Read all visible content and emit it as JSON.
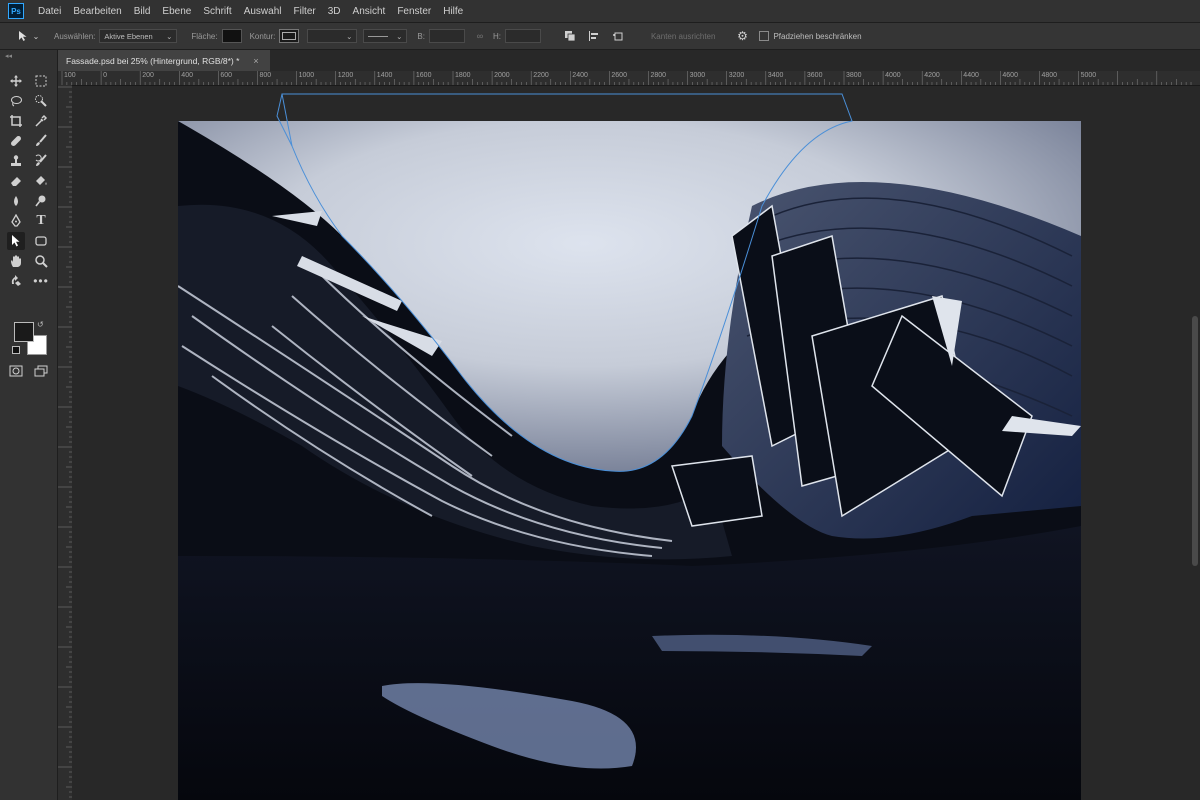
{
  "menu": {
    "app_icon": "Ps",
    "items": [
      "Datei",
      "Bearbeiten",
      "Bild",
      "Ebene",
      "Schrift",
      "Auswahl",
      "Filter",
      "3D",
      "Ansicht",
      "Fenster",
      "Hilfe"
    ]
  },
  "options": {
    "select_label": "Auswählen:",
    "select_value": "Aktive Ebenen",
    "fill_label": "Fläche:",
    "stroke_label": "Kontur:",
    "width_label": "B:",
    "height_label": "H:",
    "align_edges_label": "Kanten ausrichten",
    "constrain_label": "Pfadziehen beschränken"
  },
  "document": {
    "tab_title": "Fassade.psd bei 25% (Hintergrund, RGB/8*) *",
    "close": "×"
  },
  "ruler": {
    "top_labels": [
      "100",
      "0",
      "200",
      "400",
      "600",
      "800",
      "1000",
      "1200",
      "1400",
      "1600",
      "1800",
      "2000",
      "2200",
      "2400",
      "2600",
      "2800",
      "3000",
      "3200",
      "3400",
      "3600",
      "3800",
      "4000",
      "4200",
      "4400",
      "4600",
      "4800",
      "5000"
    ]
  },
  "colors": {
    "accent": "#31a8ff",
    "foreground": "#1a1a1a",
    "background": "#ffffff",
    "path_outline": "#4a8fd8"
  },
  "tools": [
    "move-icon",
    "marquee-icon",
    "lasso-icon",
    "quick-select-icon",
    "crop-icon",
    "eyedropper-icon",
    "healing-icon",
    "brush-icon",
    "clone-stamp-icon",
    "history-brush-icon",
    "eraser-icon",
    "paint-bucket-icon",
    "blur-icon",
    "dodge-icon",
    "pen-icon",
    "type-icon",
    "path-select-icon",
    "rectangle-icon",
    "hand-icon",
    "zoom-icon",
    "more-icon"
  ]
}
